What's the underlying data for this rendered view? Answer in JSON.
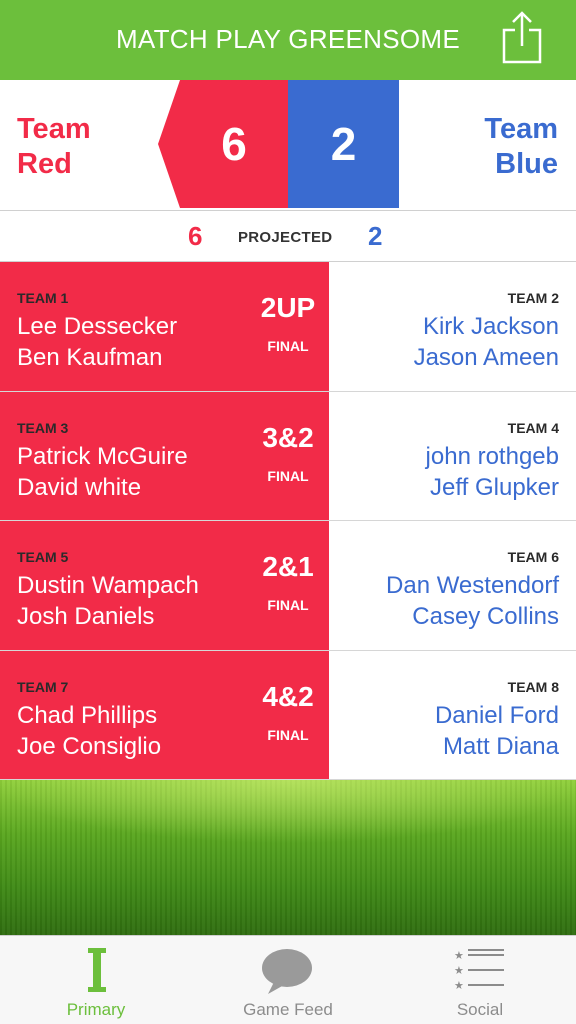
{
  "header": {
    "title": "MATCH PLAY GREENSOME"
  },
  "scoreboard": {
    "red": {
      "line1": "Team",
      "line2": "Red",
      "score": "6",
      "projected": "6"
    },
    "blue": {
      "line1": "Team",
      "line2": "Blue",
      "score": "2",
      "projected": "2"
    },
    "projected_label": "PROJECTED"
  },
  "matches": [
    {
      "red_team": "TEAM 1",
      "red_players": [
        "Lee Dessecker",
        "Ben Kaufman"
      ],
      "result": "2UP",
      "status": "FINAL",
      "blue_team": "TEAM 2",
      "blue_players": [
        "Kirk Jackson",
        "Jason Ameen"
      ]
    },
    {
      "red_team": "TEAM 3",
      "red_players": [
        "Patrick McGuire",
        "David white"
      ],
      "result": "3&2",
      "status": "FINAL",
      "blue_team": "TEAM 4",
      "blue_players": [
        "john rothgeb",
        "Jeff Glupker"
      ]
    },
    {
      "red_team": "TEAM 5",
      "red_players": [
        "Dustin Wampach",
        "Josh Daniels"
      ],
      "result": "2&1",
      "status": "FINAL",
      "blue_team": "TEAM 6",
      "blue_players": [
        "Dan Westendorf",
        "Casey Collins"
      ]
    },
    {
      "red_team": "TEAM 7",
      "red_players": [
        "Chad Phillips",
        "Joe Consiglio"
      ],
      "result": "4&2",
      "status": "FINAL",
      "blue_team": "TEAM 8",
      "blue_players": [
        "Daniel Ford",
        "Matt Diana"
      ]
    }
  ],
  "tabs": [
    {
      "label": "Primary",
      "icon": "primary-icon",
      "active": true
    },
    {
      "label": "Game Feed",
      "icon": "chat-bubble-icon",
      "active": false
    },
    {
      "label": "Social",
      "icon": "list-icon",
      "active": false
    }
  ],
  "colors": {
    "green": "#6cbf3c",
    "red": "#f22b48",
    "blue": "#3a6bd0"
  }
}
